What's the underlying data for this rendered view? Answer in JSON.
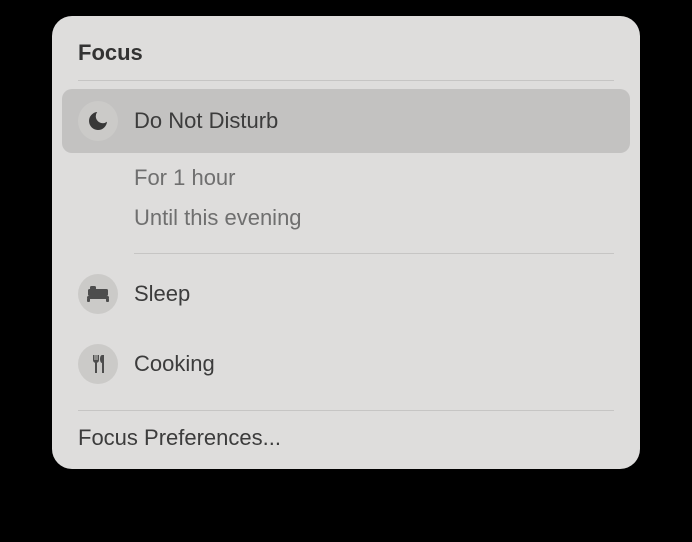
{
  "panel": {
    "title": "Focus",
    "preferences_label": "Focus Preferences..."
  },
  "modes": [
    {
      "icon": "moon-icon",
      "label": "Do Not Disturb"
    },
    {
      "icon": "bed-icon",
      "label": "Sleep"
    },
    {
      "icon": "utensils-icon",
      "label": "Cooking"
    }
  ],
  "dnd_options": [
    "For 1 hour",
    "Until this evening"
  ]
}
